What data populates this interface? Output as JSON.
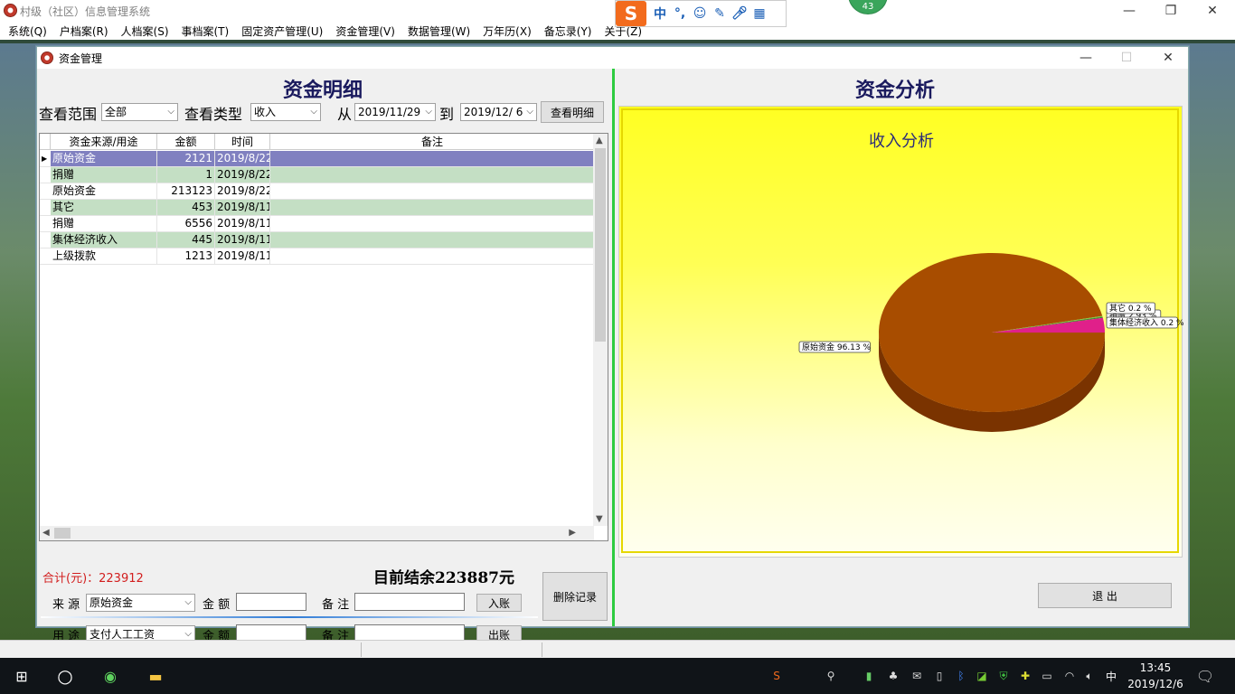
{
  "app": {
    "title": "村级（社区）信息管理系统",
    "menu": [
      "系统(Q)",
      "户档案(R)",
      "人档案(S)",
      "事档案(T)",
      "固定资产管理(U)",
      "资金管理(V)",
      "数据管理(W)",
      "万年历(X)",
      "备忘录(Y)",
      "关于(Z)"
    ],
    "controls": {
      "minimize": "—",
      "maximize": "❐",
      "close": "✕"
    }
  },
  "ime": {
    "logo": "S",
    "mode": "中",
    "punct": "°,",
    "badge": "43"
  },
  "window": {
    "title": "资金管理",
    "controls": {
      "minimize": "—",
      "maximize": "☐",
      "close": "✕"
    }
  },
  "left": {
    "heading": "资金明细",
    "filter": {
      "range_label": "查看范围",
      "range_value": "全部",
      "type_label": "查看类型",
      "type_value": "收入",
      "from_label": "从",
      "from_date": "2019/11/29",
      "to_label": "到",
      "to_date": "2019/12/ 6",
      "view_button": "查看明细"
    },
    "grid": {
      "columns": [
        "资金来源/用途",
        "金额",
        "时间",
        "备注"
      ],
      "rows": [
        {
          "source": "原始资金",
          "amount": "2121",
          "date": "2019/8/22",
          "note": ""
        },
        {
          "source": "捐赠",
          "amount": "1",
          "date": "2019/8/22",
          "note": ""
        },
        {
          "source": "原始资金",
          "amount": "213123",
          "date": "2019/8/22",
          "note": ""
        },
        {
          "source": "其它",
          "amount": "453",
          "date": "2019/8/11",
          "note": ""
        },
        {
          "source": "捐赠",
          "amount": "6556",
          "date": "2019/8/11",
          "note": ""
        },
        {
          "source": "集体经济收入",
          "amount": "445",
          "date": "2019/8/11",
          "note": ""
        },
        {
          "source": "上级拨款",
          "amount": "1213",
          "date": "2019/8/11",
          "note": ""
        }
      ]
    },
    "total": "合计(元)：223912",
    "balance": "目前结余223887元",
    "income_form": {
      "source_label": "来 源",
      "source_value": "原始资金",
      "amount_label": "金 额",
      "note_label": "备 注",
      "button": "入账"
    },
    "expense_form": {
      "use_label": "用 途",
      "use_value": "支付人工工资",
      "amount_label": "金 额",
      "note_label": "备 注",
      "button": "出账"
    },
    "delete_button": "删除记录"
  },
  "right": {
    "heading": "资金分析",
    "exit_button": "退 出"
  },
  "chart_data": {
    "type": "pie",
    "title": "收入分析",
    "slices": [
      {
        "label": "原始资金 96.13 %",
        "name": "原始资金",
        "value": 96.13,
        "color": "#a84d00",
        "labelSide": "left"
      },
      {
        "label": "捐赠 2.93 %",
        "name": "捐赠",
        "value": 2.93,
        "color": "#e0208a",
        "labelSide": "right"
      },
      {
        "label": "集体经济收入 0.2 %",
        "name": "集体经济收入",
        "value": 0.2,
        "color": "#2f7d2f",
        "labelSide": "right"
      },
      {
        "label": "其它 0.2 %",
        "name": "其它",
        "value": 0.2,
        "color": "#7fc04a",
        "labelSide": "right"
      }
    ]
  },
  "taskbar": {
    "time": "13:45",
    "date": "2019/12/6",
    "lang": "中"
  },
  "colors": {
    "accent_green": "#2ecc40",
    "selected_row": "#8080c0",
    "alt_row": "#c4dfc4",
    "total_red": "#d21e1e"
  }
}
